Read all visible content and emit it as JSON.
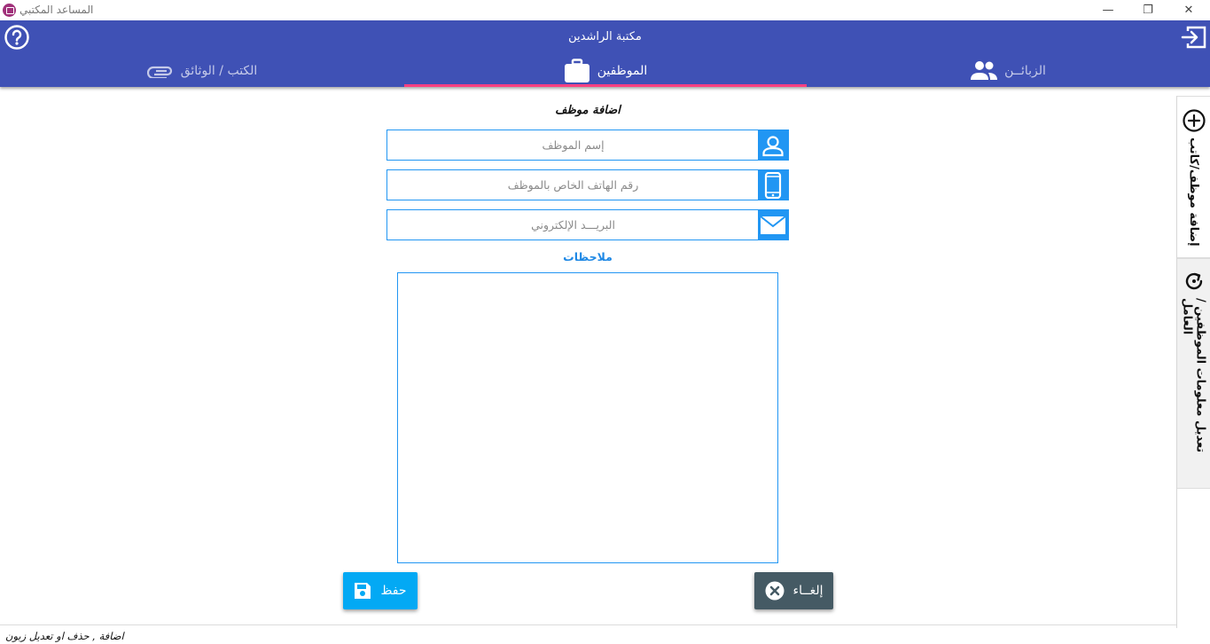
{
  "window": {
    "title": "المساعد المكتبي",
    "minimize_glyph": "—",
    "restore_glyph": "❐",
    "close_glyph": "✕"
  },
  "header": {
    "title": "مكتبة الراشدين",
    "help_icon": "help-circle-icon",
    "exit_icon": "exit-icon"
  },
  "tabs": [
    {
      "label": "الكتب / الوثائق",
      "icon": "paperclip-icon",
      "active": false
    },
    {
      "label": "الموظفين",
      "icon": "briefcase-icon",
      "active": true
    },
    {
      "label": "الزبائــن",
      "icon": "people-icon",
      "active": false
    }
  ],
  "colors": {
    "header": "#3f51b5",
    "tab_indicator": "#ff4081",
    "accent": "#2196f3",
    "save_button": "#03a9f4",
    "cancel_button": "#455a64"
  },
  "form": {
    "title": "اضافة موظف",
    "name_placeholder": "إسم الموظف",
    "phone_placeholder": "رقم الهاتف الخاص بالموظف",
    "email_placeholder": "البريـــد الإلكتروني",
    "name_value": "",
    "phone_value": "",
    "email_value": "",
    "notes_label": "ملاحظات",
    "notes_value": ""
  },
  "buttons": {
    "save_label": "حفظ",
    "cancel_label": "إلغــاء"
  },
  "side_tabs": [
    {
      "label": "إضافة موظف/كاتب",
      "icon": "add-circle-icon"
    },
    {
      "label": "تعديل معلومات الموظفين / العامل",
      "icon": "refresh-icon"
    }
  ],
  "status": {
    "text": "اضافة , حذف او تعديل زبون"
  }
}
